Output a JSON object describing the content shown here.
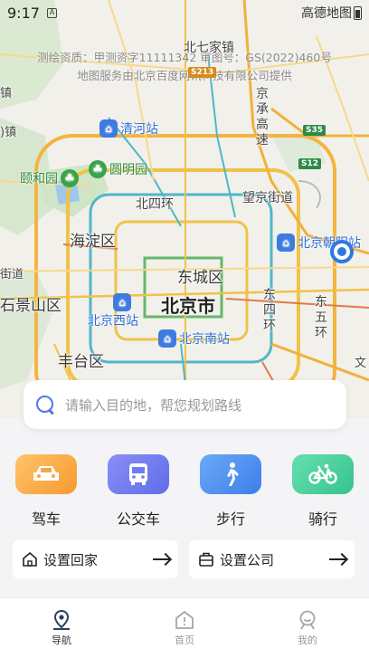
{
  "status_bar": {
    "time": "9:17",
    "sim_icon": "A",
    "right_text": "高德地图"
  },
  "map": {
    "copyright_line1": "测绘资质：甲测资字11111342 审图号：GS(2022)460号",
    "copyright_line2": "地图服务由北京百度网讯科技有限公司提供",
    "city": "北京市",
    "districts": {
      "haidian": "海淀区",
      "dongcheng": "东城区",
      "shijingshan": "石景山区",
      "fengtai": "丰台区"
    },
    "labels": {
      "beiqijia": "北七家镇",
      "zhen_left": "镇",
      "zhen_left2": ")镇",
      "beisihuan": "北四环",
      "wangjing": "望京街道",
      "jiedao": "街道",
      "jing_cheng": "京承高速",
      "dongsihuan": "东四环",
      "dongwuhuan": "东五环",
      "wen": "文"
    },
    "shields": {
      "s213": "S213",
      "s35": "S35",
      "s12": "S12"
    },
    "pois": {
      "qinghe": "清河站",
      "yiheyuan": "颐和园",
      "yuanmingyuan": "圆明园",
      "beijing_chaoyang": "北京朝阳站",
      "beijing_xi": "北京西站",
      "beijing_nan": "北京南站"
    }
  },
  "search": {
    "placeholder": "请输入目的地，帮您规划路线"
  },
  "modes": [
    {
      "label": "驾车",
      "icon": "car-icon",
      "color": "#f9a13a"
    },
    {
      "label": "公交车",
      "icon": "bus-icon",
      "color": "#6d7bf0"
    },
    {
      "label": "步行",
      "icon": "walk-icon",
      "color": "#4d8ff2"
    },
    {
      "label": "骑行",
      "icon": "bike-icon",
      "color": "#3fcf9a"
    }
  ],
  "quick": {
    "home": "设置回家",
    "company": "设置公司"
  },
  "tabs": [
    {
      "label": "导航",
      "icon": "navigation-icon"
    },
    {
      "label": "首页",
      "icon": "home-icon"
    },
    {
      "label": "我的",
      "icon": "profile-icon"
    }
  ]
}
